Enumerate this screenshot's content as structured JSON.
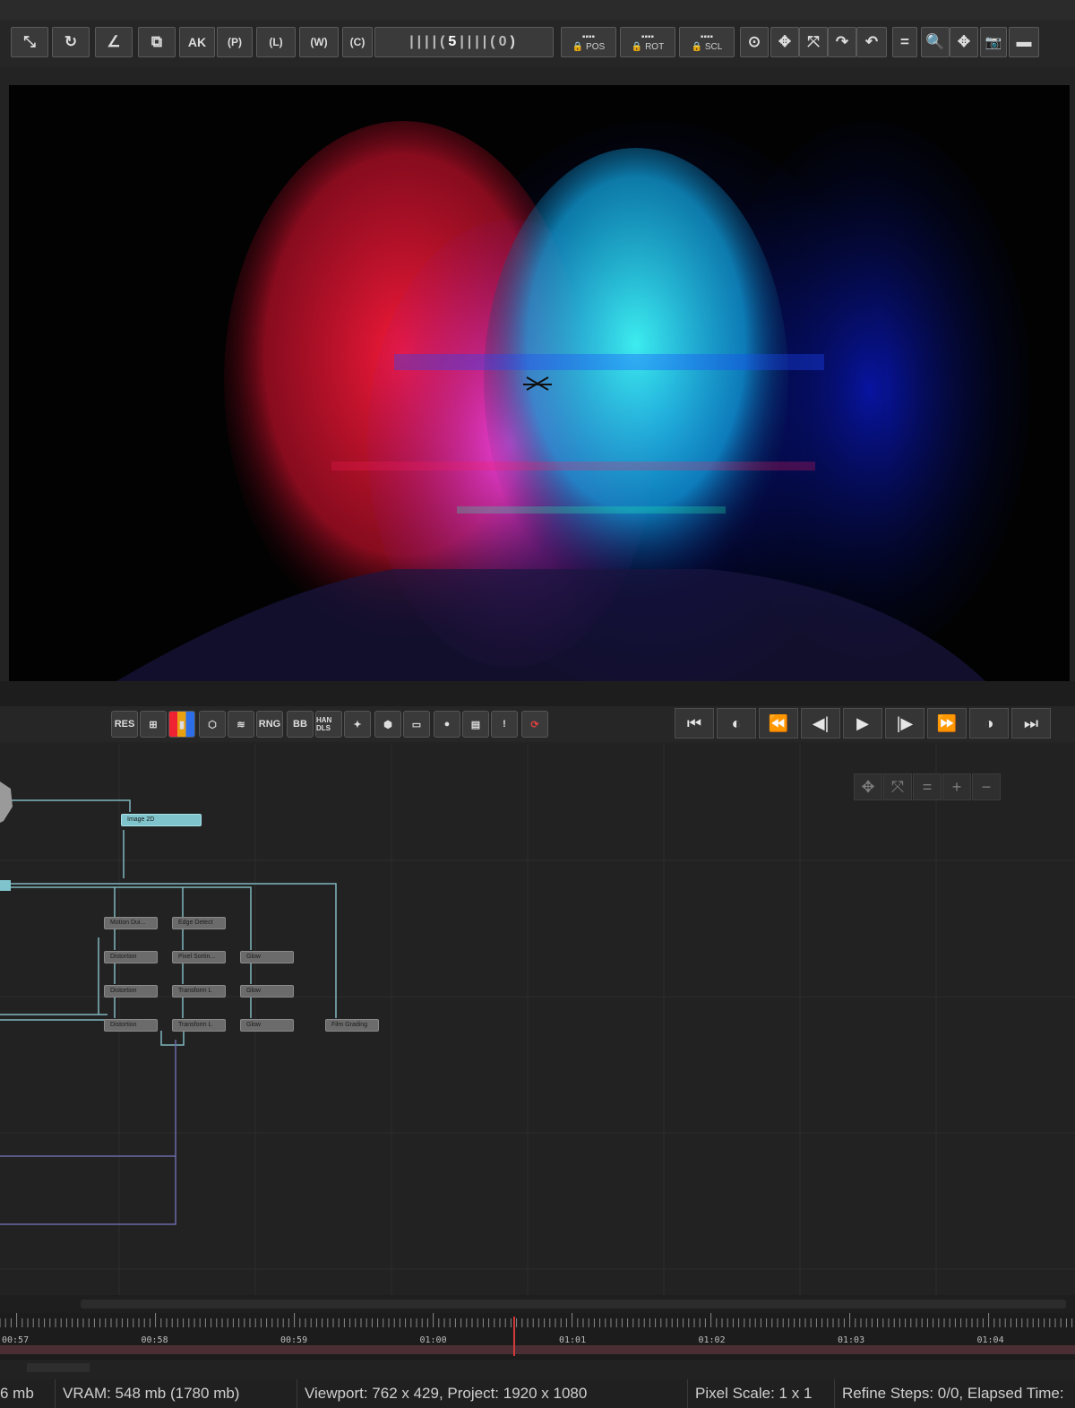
{
  "toolbar": {
    "tools": [
      {
        "name": "axis-tool-icon",
        "glyph": "⤡"
      },
      {
        "name": "rotate-tool-icon",
        "glyph": "↻"
      },
      {
        "name": "angle-tool-icon",
        "glyph": "∠"
      },
      {
        "name": "scale-tool-icon",
        "glyph": "⧉"
      },
      {
        "name": "ak-tool",
        "glyph": "AK"
      },
      {
        "name": "point-tool",
        "glyph": "(P)"
      },
      {
        "name": "local-tool",
        "glyph": "(L)"
      },
      {
        "name": "world-tool",
        "glyph": "(W)"
      },
      {
        "name": "camera-tool",
        "glyph": "(C)"
      }
    ],
    "snap_value": "5",
    "snap_zero": "0",
    "lock_pos": "POS",
    "lock_rot": "ROT",
    "lock_scl": "SCL",
    "right_tools": [
      "⊙",
      "✥",
      "⤧",
      "↷",
      "↶",
      "=",
      "🔍",
      "✥",
      "📷",
      "▬"
    ]
  },
  "viewer_controls": {
    "buttons": [
      "RES",
      "⊞",
      "▮",
      "⬡",
      "≋",
      "RNG",
      "BB",
      "HAN DLS",
      "✦",
      "⬢",
      "▭",
      "●",
      "▤",
      "!",
      "⟳"
    ],
    "playback": [
      "⏮",
      "◐",
      "⏪",
      "◀|",
      "▶",
      "|▶",
      "⏩",
      "◑",
      "⏭"
    ]
  },
  "nodegraph": {
    "view_tools": [
      "✥",
      "⤧",
      "=",
      "+",
      "−"
    ],
    "nodes": [
      {
        "id": "image2d",
        "label": "Image 2D",
        "style": "cyan"
      },
      {
        "id": "motion",
        "label": "Motion Dui...",
        "style": "grey"
      },
      {
        "id": "edge",
        "label": "Edge Detect",
        "style": "grey"
      },
      {
        "id": "dist1",
        "label": "Distortion",
        "style": "grey"
      },
      {
        "id": "pixel",
        "label": "Pixel Sortin...",
        "style": "grey"
      },
      {
        "id": "glow1",
        "label": "Glow",
        "style": "grey"
      },
      {
        "id": "dist2",
        "label": "Distortion",
        "style": "grey"
      },
      {
        "id": "trans1",
        "label": "Transform L",
        "style": "grey"
      },
      {
        "id": "glow2",
        "label": "Glow",
        "style": "grey"
      },
      {
        "id": "dist3",
        "label": "Distortion",
        "style": "grey"
      },
      {
        "id": "trans2",
        "label": "Transform L",
        "style": "grey"
      },
      {
        "id": "glow3",
        "label": "Glow",
        "style": "grey"
      },
      {
        "id": "grade",
        "label": "Film Grading",
        "style": "grey"
      }
    ]
  },
  "timeline": {
    "labels": [
      "00:57",
      "00:58",
      "00:59",
      "01:00",
      "01:01",
      "01:02",
      "01:03",
      "01:04"
    ],
    "playhead_color": "#d23a3a"
  },
  "status": {
    "ram": "6 mb",
    "vram": "VRAM: 548 mb (1780 mb)",
    "viewport": "Viewport: 762 x 429, Project: 1920 x 1080",
    "pixel_scale": "Pixel Scale: 1 x 1",
    "refine": "Refine Steps: 0/0, Elapsed Time:"
  },
  "colors": {
    "accent_cyan": "#7fc3cc",
    "wire_cyan": "#7fb7c0",
    "wire_blue": "#6a6aa8",
    "face_red": "#ff1a3c",
    "face_magenta": "#ff3cff",
    "face_cyan": "#2ff5f5",
    "face_blue": "#1a2cff"
  }
}
